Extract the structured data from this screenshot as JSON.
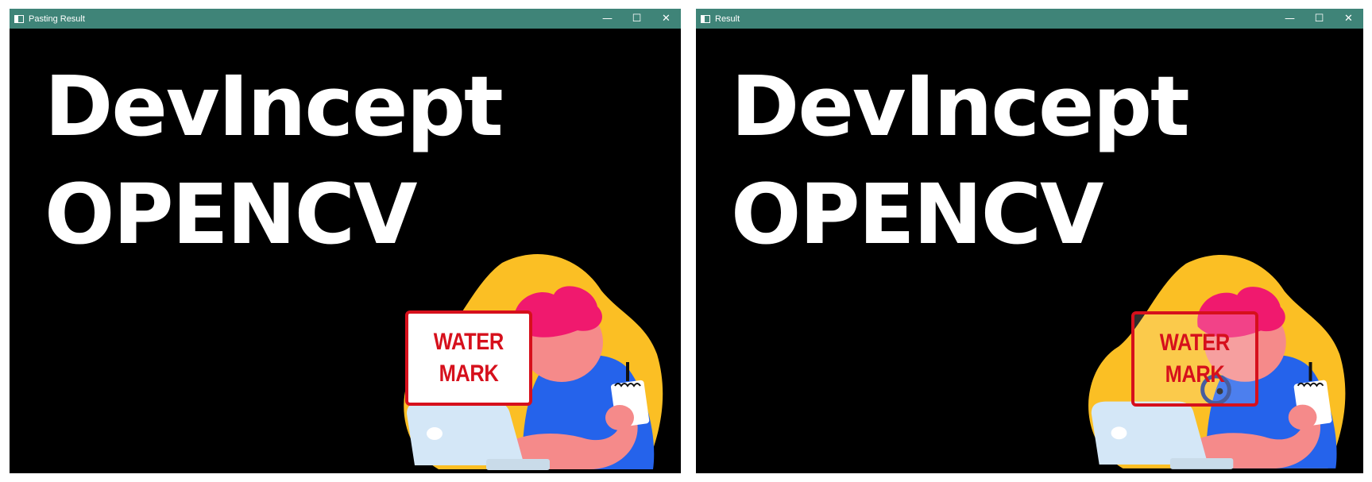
{
  "windows": [
    {
      "title": "Pasting Result",
      "controls": {
        "minimize": "—",
        "maximize": "☐",
        "close": "✕"
      },
      "headline": [
        "DevIncept",
        "OPENCV"
      ],
      "watermark": [
        "WATER",
        "MARK"
      ]
    },
    {
      "title": "Result",
      "controls": {
        "minimize": "—",
        "maximize": "☐",
        "close": "✕"
      },
      "headline": [
        "DevIncept",
        "OPENCV"
      ],
      "watermark": [
        "WATER",
        "MARK"
      ]
    }
  ],
  "colors": {
    "titlebar": "#3f8478",
    "canvas": "#000000",
    "watermark_red": "#d6101c",
    "blob_yellow": "#fbbf24",
    "hair_pink": "#f0196e",
    "skin": "#f58a8a",
    "shirt_blue": "#2563eb",
    "laptop": "#d4e7f7"
  },
  "icons": [
    "app-window-icon",
    "minimize-icon",
    "maximize-icon",
    "close-icon"
  ]
}
